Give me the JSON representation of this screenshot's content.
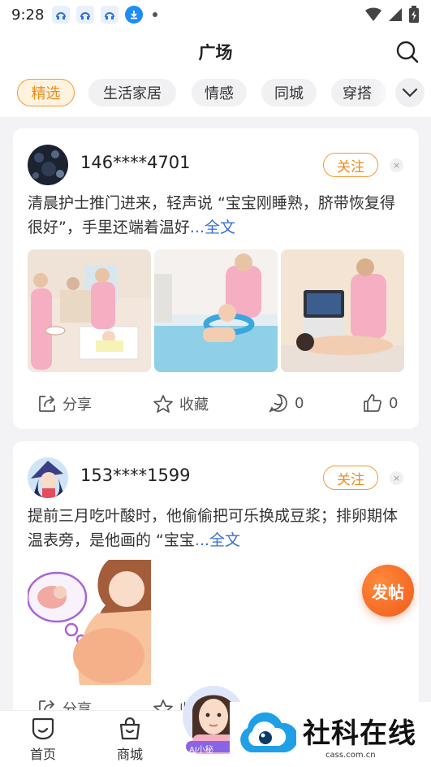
{
  "status_bar": {
    "time": "9:28"
  },
  "header": {
    "title": "广场"
  },
  "tabs": [
    {
      "label": "精选",
      "active": true
    },
    {
      "label": "生活家居",
      "active": false
    },
    {
      "label": "情感",
      "active": false
    },
    {
      "label": "同城",
      "active": false
    },
    {
      "label": "穿搭",
      "active": false
    }
  ],
  "posts": [
    {
      "username": "146****4701",
      "follow_label": "关注",
      "text": "清晨护士推门进来，轻声说 “宝宝刚睡熟，脐带恢复得很好”，手里还端着温好",
      "more": "...全文",
      "actions": {
        "share": "分享",
        "collect": "收藏",
        "comments": "0",
        "likes": "0"
      }
    },
    {
      "username": "153****1599",
      "follow_label": "关注",
      "text": "提前三月吃叶酸时，他偷偷把可乐换成豆浆；排卵期体温表旁，是他画的 “宝宝",
      "more": "...全文",
      "actions": {
        "share": "分享",
        "collect": "收藏"
      }
    }
  ],
  "fab": {
    "label": "发帖"
  },
  "bottom_nav": [
    {
      "label": "首页"
    },
    {
      "label": "商城"
    }
  ],
  "ai_badge": "AI小秘",
  "watermark": {
    "title": "社科在线",
    "url": "cass.com.cn"
  },
  "colors": {
    "accent": "#ef8b1a",
    "link": "#3a6ed4",
    "fab": "#f05a1a"
  }
}
